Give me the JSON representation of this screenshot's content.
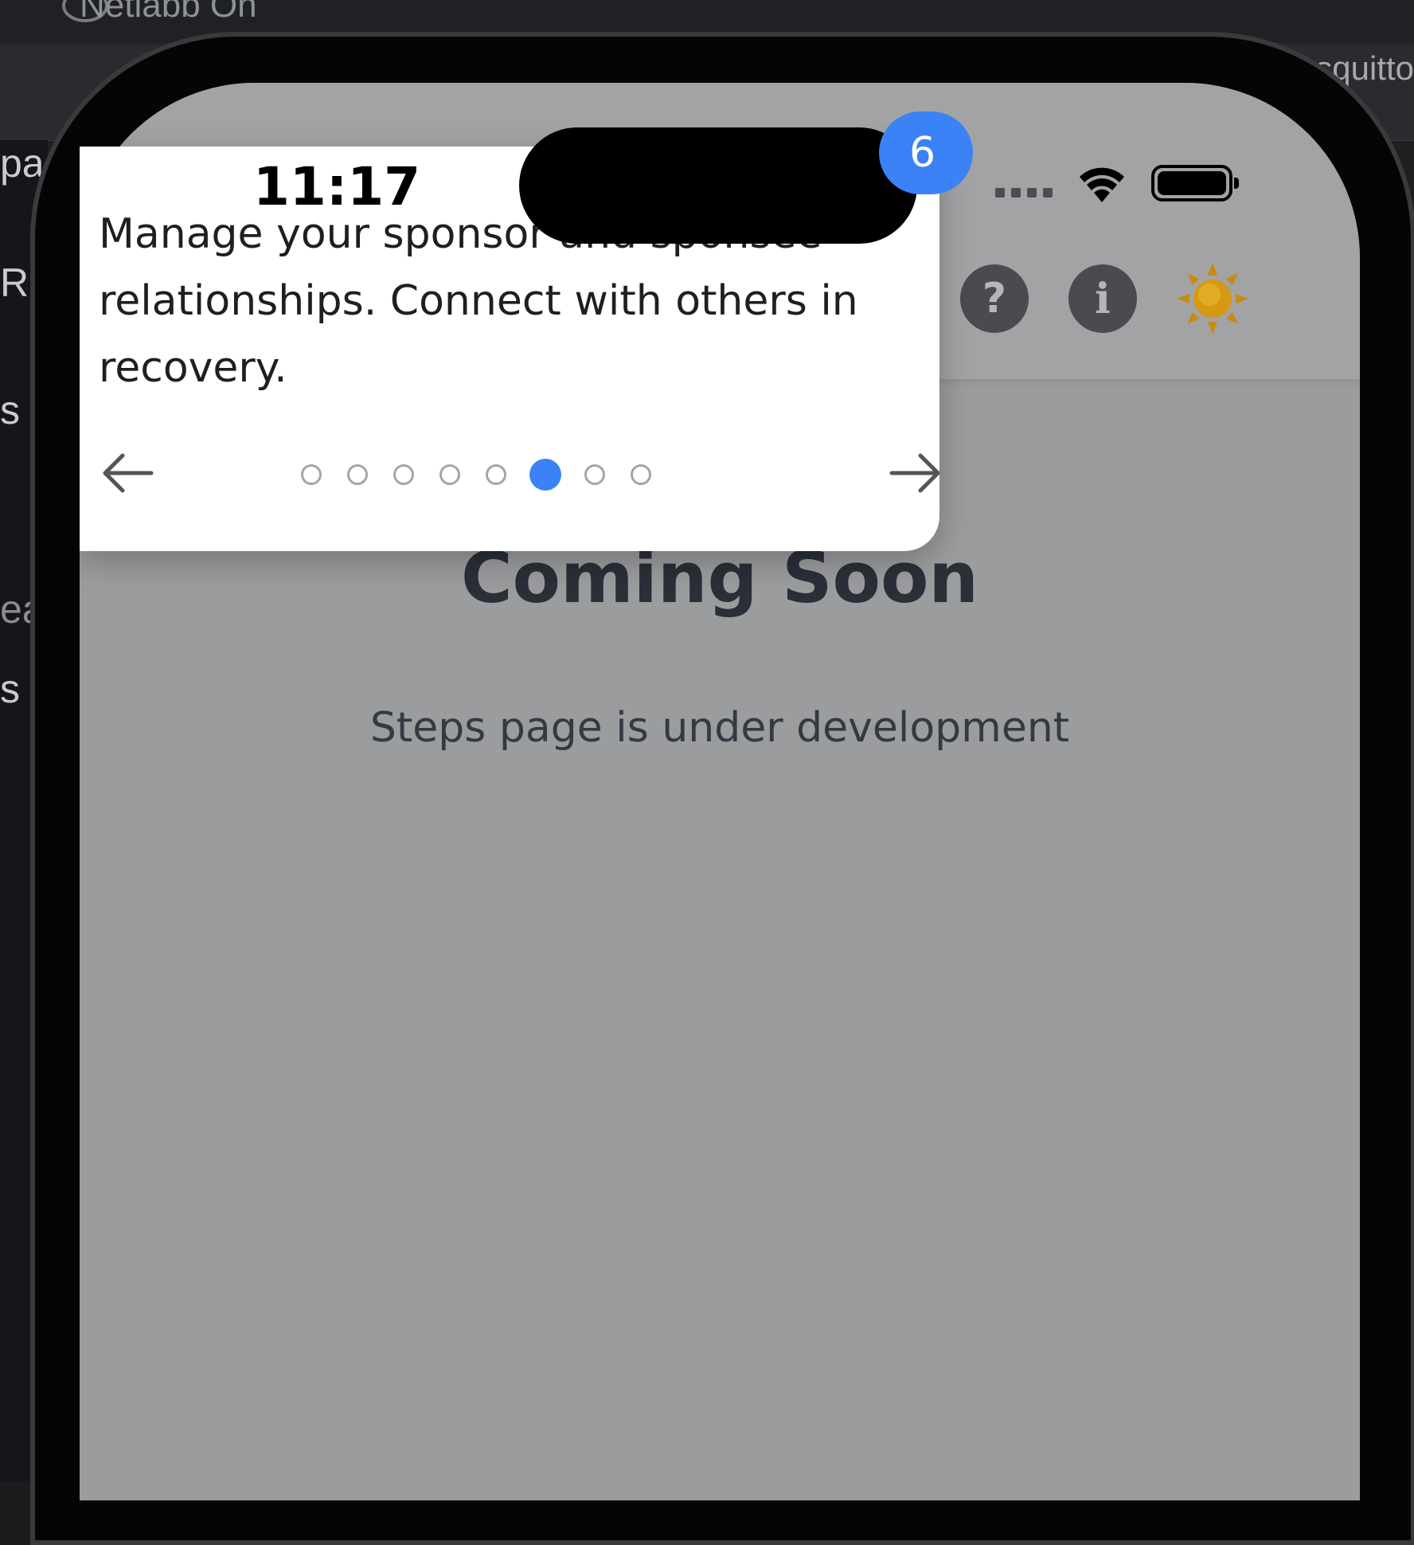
{
  "desktop": {
    "window_title": "Netlabb On",
    "right_text": "squitto",
    "sidebar_fragments": [
      "pa",
      "R",
      "s",
      "ea",
      "s"
    ]
  },
  "phone": {
    "status_bar": {
      "time": "11:17"
    },
    "header": {
      "help_icon": "?",
      "info_icon": "i"
    },
    "content": {
      "title": "Coming Soon",
      "subtitle": "Steps page is under development"
    },
    "tour": {
      "step_badge": "6",
      "text": "Manage your sponsor and sponsee relationships. Connect with others in recovery.",
      "total_steps": 8,
      "current_step": 6
    }
  },
  "colors": {
    "accent": "#3b82f6",
    "overlay": "#9b9c9e",
    "title": "#2a2f38"
  }
}
